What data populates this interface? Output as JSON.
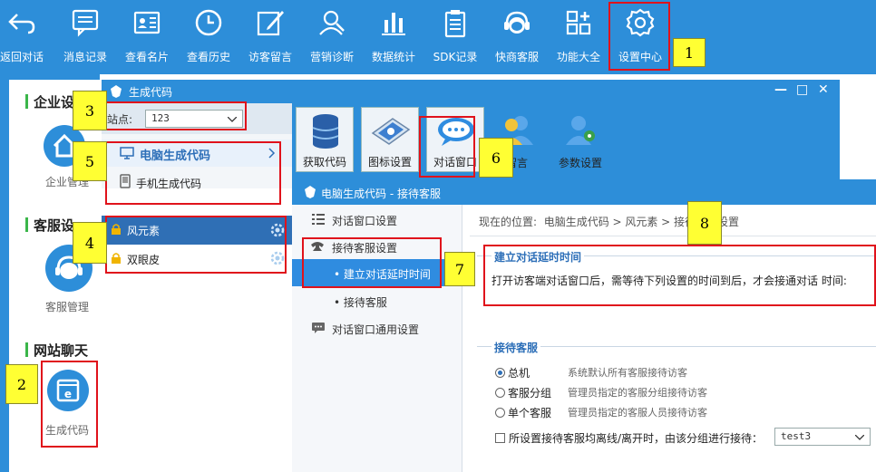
{
  "topbar": {
    "items": [
      {
        "label": "返回对话",
        "icon": "back-arrow-icon"
      },
      {
        "label": "消息记录",
        "icon": "chat-log-icon"
      },
      {
        "label": "查看名片",
        "icon": "card-icon"
      },
      {
        "label": "查看历史",
        "icon": "clock-icon"
      },
      {
        "label": "访客留言",
        "icon": "edit-icon"
      },
      {
        "label": "营销诊断",
        "icon": "diagnose-icon"
      },
      {
        "label": "数据统计",
        "icon": "bar-chart-icon"
      },
      {
        "label": "SDK记录",
        "icon": "clipboard-icon"
      },
      {
        "label": "快商客服",
        "icon": "service-icon"
      },
      {
        "label": "功能大全",
        "icon": "grid-plus-icon"
      },
      {
        "label": "设置中心",
        "icon": "gear-icon"
      }
    ]
  },
  "sidebar": {
    "sections": [
      {
        "title": "企业设",
        "item_label": "企业管理"
      },
      {
        "title": "客服设",
        "item_label": "客服管理"
      },
      {
        "title": "网站聊天",
        "item_label": "生成代码"
      }
    ]
  },
  "window": {
    "title": "生成代码",
    "controls": {
      "minimize": "—",
      "maximize": "□",
      "close": "✕"
    },
    "site_label": "站点:",
    "site_value": "123",
    "pc_code": "电脑生成代码",
    "mobile_code": "手机生成代码",
    "sites": [
      {
        "name": "风元素"
      },
      {
        "name": "双眼皮"
      }
    ],
    "tools": [
      {
        "label": "获取代码"
      },
      {
        "label": "图标设置"
      },
      {
        "label": "对话窗口"
      },
      {
        "label": "留言"
      },
      {
        "label": "参数设置"
      }
    ]
  },
  "dialog": {
    "title": "电脑生成代码 - 接待客服",
    "side": {
      "item1": "对话窗口设置",
      "item2": "接待客服设置",
      "sub1": "建立对话延时时间",
      "sub2": "接待客服",
      "item3": "对话窗口通用设置"
    },
    "breadcrumb": {
      "prefix": "现在的位置:",
      "path": "电脑生成代码 > 风元素 > 接待客服设置"
    },
    "delay": {
      "legend": "建立对话延时时间",
      "text": "打开访客端对话窗口后，需等待下列设置的时间到后，才会接通对话  时间:"
    },
    "reception": {
      "legend": "接待客服",
      "options": [
        {
          "name": "总机",
          "desc": "系统默认所有客服接待访客",
          "selected": true
        },
        {
          "name": "客服分组",
          "desc": "管理员指定的客服分组接待访客",
          "selected": false
        },
        {
          "name": "单个客服",
          "desc": "管理员指定的客服人员接待访客",
          "selected": false
        }
      ],
      "offline_label": "所设置接待客服均离线/离开时，由该分组进行接待：",
      "group_value": "test3"
    }
  },
  "annotations": [
    "1",
    "2",
    "3",
    "4",
    "5",
    "6",
    "7",
    "8"
  ],
  "colors": {
    "brand_blue": "#2d8ed9",
    "annotation_red": "#e0121b",
    "annotation_yellow": "#ffff33",
    "selected_row": "#2f6fb5"
  }
}
